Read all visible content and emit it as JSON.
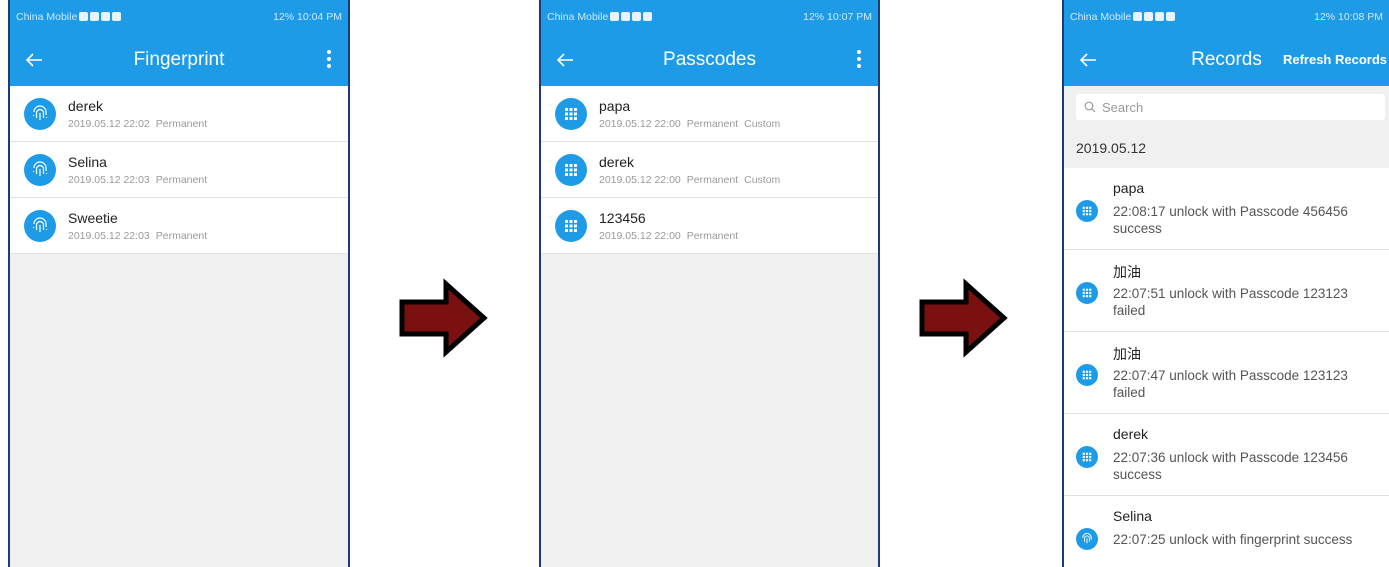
{
  "screens": [
    {
      "status": {
        "carrier": "China Mobile",
        "signal": "12%",
        "time": "10:04 PM"
      },
      "title": "Fingerprint",
      "items": [
        {
          "name": "derek",
          "date": "2019.05.12 22:02",
          "validity": "Permanent",
          "type": ""
        },
        {
          "name": "Selina",
          "date": "2019.05.12 22:03",
          "validity": "Permanent",
          "type": ""
        },
        {
          "name": "Sweetie",
          "date": "2019.05.12 22:03",
          "validity": "Permanent",
          "type": ""
        }
      ]
    },
    {
      "status": {
        "carrier": "China Mobile",
        "signal": "12%",
        "time": "10:07 PM"
      },
      "title": "Passcodes",
      "items": [
        {
          "name": "papa",
          "date": "2019.05.12 22:00",
          "validity": "Permanent",
          "type": "Custom"
        },
        {
          "name": "derek",
          "date": "2019.05.12 22:00",
          "validity": "Permanent",
          "type": "Custom"
        },
        {
          "name": "123456",
          "date": "2019.05.12 22:00",
          "validity": "Permanent",
          "type": ""
        }
      ]
    },
    {
      "status": {
        "carrier": "China Mobile",
        "signal": "12%",
        "time": "10:08 PM"
      },
      "title": "Records",
      "refresh_label": "Refresh Records",
      "search_placeholder": "Search",
      "date_group": "2019.05.12",
      "records": [
        {
          "name": "papa",
          "line1": "22:08:17 unlock with Passcode 456456",
          "line2": "success",
          "icon": "keypad"
        },
        {
          "name": "加油",
          "line1": "22:07:51 unlock with Passcode 123123",
          "line2": "failed",
          "icon": "keypad"
        },
        {
          "name": "加油",
          "line1": "22:07:47 unlock with Passcode 123123",
          "line2": "failed",
          "icon": "keypad"
        },
        {
          "name": "derek",
          "line1": "22:07:36 unlock with Passcode 123456",
          "line2": "success",
          "icon": "keypad"
        },
        {
          "name": "Selina",
          "line1": "22:07:25 unlock with fingerprint success",
          "line2": "",
          "icon": "fingerprint"
        }
      ]
    }
  ],
  "colors": {
    "header": "#1e9be6",
    "arrow_fill": "#7a1010",
    "arrow_stroke": "#000000",
    "frame": "#1e3a78"
  }
}
